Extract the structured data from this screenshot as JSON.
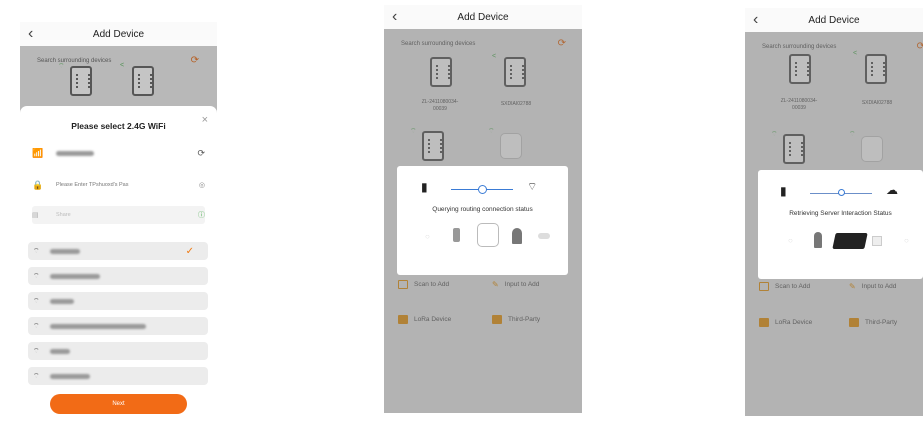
{
  "screens": {
    "wifi": {
      "header": {
        "title": "Add Device",
        "back": "‹"
      },
      "search_label": "Search surrounding devices",
      "refresh_icon": "refresh-icon",
      "sheet": {
        "title": "Please select 2.4G WiFi",
        "close": "×",
        "password_placeholder": "Please Enter TPshuoxd's Pas",
        "share_label": "Share",
        "next_label": "Next"
      },
      "selected_check": "✓",
      "accent_color": "#f26b16"
    },
    "querying": {
      "header": {
        "title": "Add Device",
        "back": "‹"
      },
      "search_label": "Search surrounding devices",
      "tiles": [
        {
          "name": "ZL-2411080034-\n00039"
        },
        {
          "name": "SXDIAI02788"
        }
      ],
      "status": "Querying routing connection status",
      "actions": {
        "scan": "Scan to Add",
        "input": "Input to Add",
        "lora": "LoRa Device",
        "third": "Third-Party"
      }
    },
    "retrieving": {
      "header": {
        "title": "Add Device",
        "back": "‹"
      },
      "search_label": "Search surrounding devices",
      "tiles": [
        {
          "name": "ZL-2411080034-\n00039"
        },
        {
          "name": "SXDIAI02788"
        }
      ],
      "status": "Retrieving Server Interaction Status",
      "actions": {
        "scan": "Scan to Add",
        "input": "Input to Add",
        "lora": "LoRa Device",
        "third": "Third-Party"
      }
    }
  }
}
